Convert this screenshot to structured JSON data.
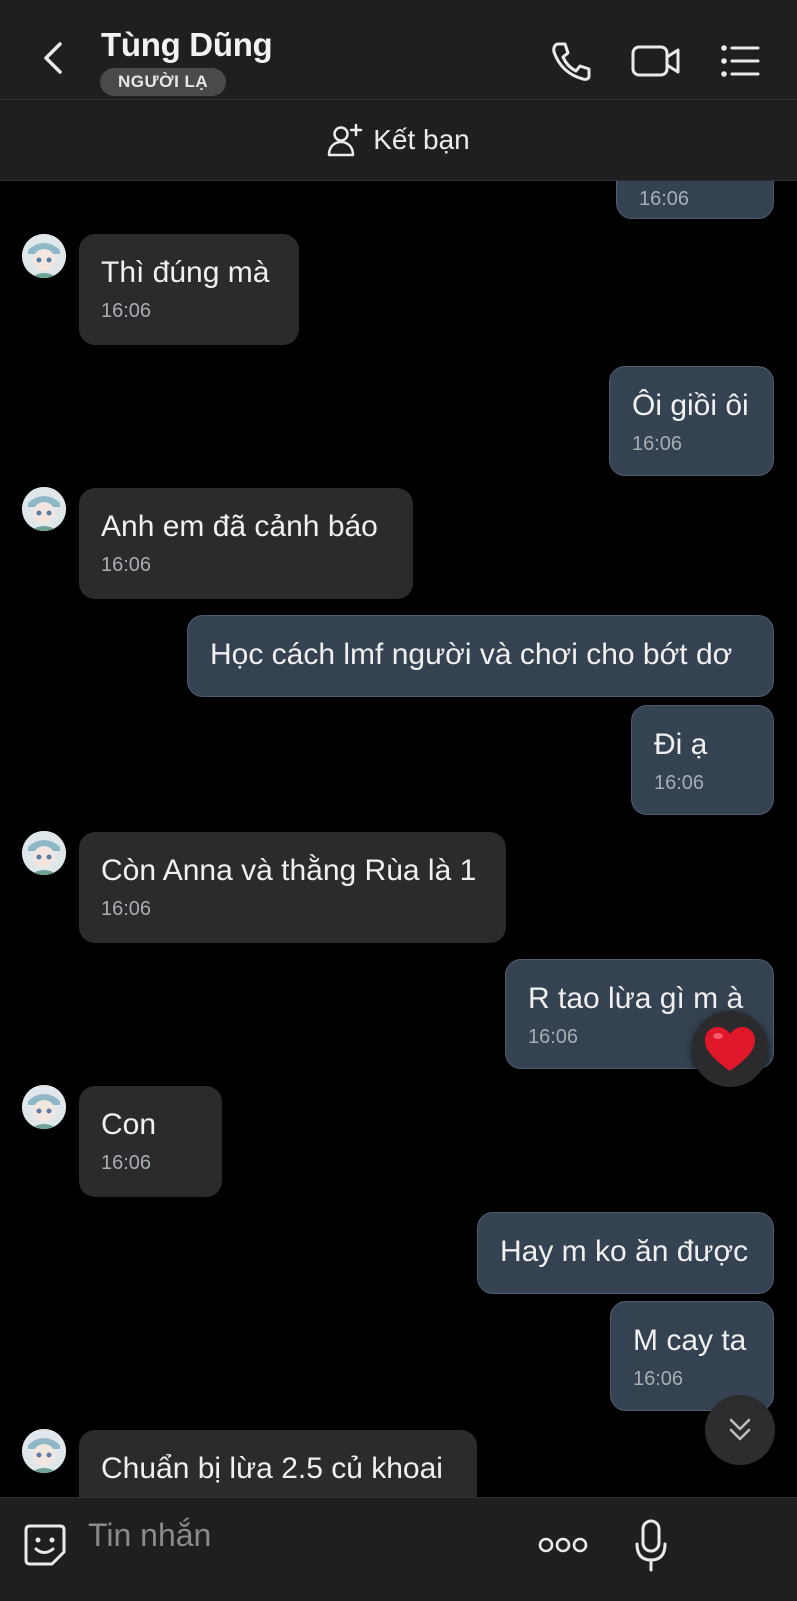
{
  "header": {
    "contact_name": "Tùng Dũng",
    "stranger_badge": "NGƯỜI LẠ"
  },
  "add_friend": {
    "label": "Kết bạn"
  },
  "messages": [
    {
      "dir": "out",
      "text": "",
      "time": "16:06"
    },
    {
      "dir": "in",
      "text": "Thì đúng mà",
      "time": "16:06"
    },
    {
      "dir": "out",
      "text": "Ôi giồi ôi",
      "time": "16:06"
    },
    {
      "dir": "in",
      "text": "Anh em đã cảnh báo",
      "time": "16:06"
    },
    {
      "dir": "out",
      "text": "Học cách lmf người và chơi cho bớt dơ",
      "time": ""
    },
    {
      "dir": "out",
      "text": "Đi ạ",
      "time": "16:06"
    },
    {
      "dir": "in",
      "text": "Còn Anna và thằng Rùa là 1",
      "time": "16:06"
    },
    {
      "dir": "out",
      "text": "R tao lừa gì m à",
      "time": "16:06",
      "reaction": "heart"
    },
    {
      "dir": "in",
      "text": "Con",
      "time": "16:06"
    },
    {
      "dir": "out",
      "text": "Hay m ko ăn được",
      "time": ""
    },
    {
      "dir": "out",
      "text": "M cay ta",
      "time": "16:06"
    },
    {
      "dir": "in",
      "text": "Chuẩn bị lừa 2.5 củ khoai",
      "time": ""
    }
  ],
  "composer": {
    "placeholder": "Tin nhắn"
  },
  "colors": {
    "background": "#000000",
    "header": "#1f1f21",
    "incoming_bubble": "#2b2b2d",
    "outgoing_bubble": "#354251",
    "heart": "#e0162b"
  }
}
